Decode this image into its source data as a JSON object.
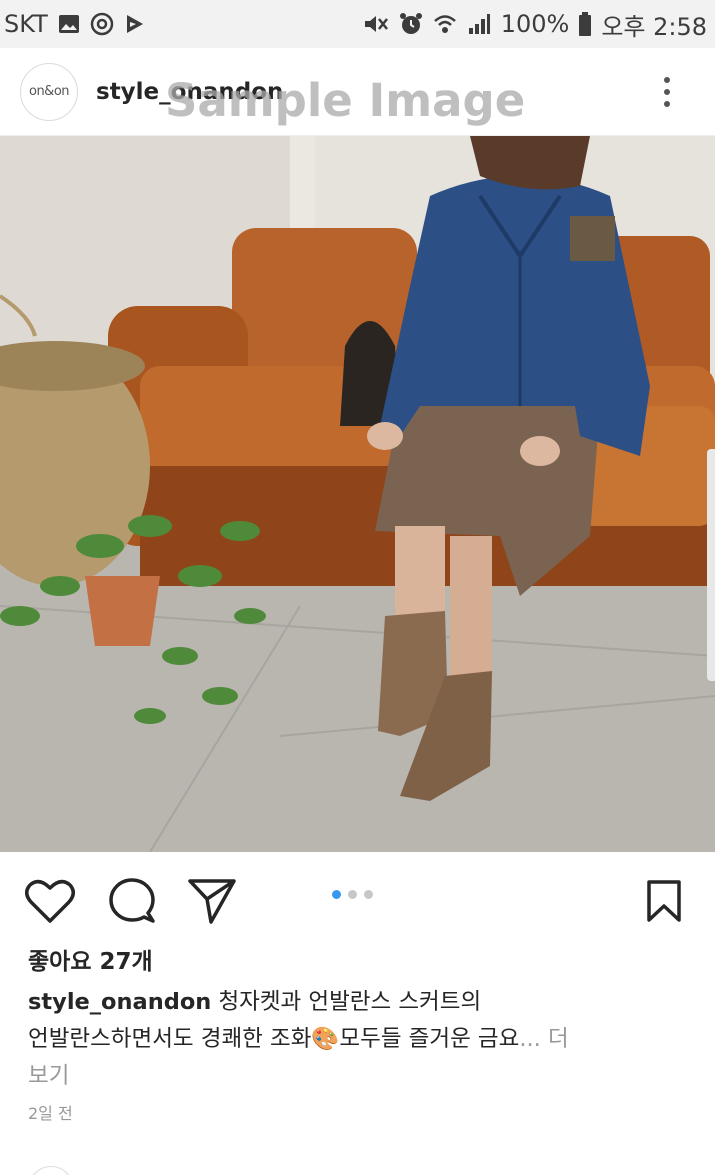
{
  "status_bar": {
    "carrier": "SKT",
    "battery": "100%",
    "time": "오후 2:58",
    "icons": [
      "gallery-icon",
      "sync-icon",
      "play-store-icon",
      "mute-icon",
      "alarm-icon",
      "wifi-icon",
      "signal-icon",
      "battery-icon"
    ]
  },
  "post": {
    "avatar_text": "on&on",
    "username": "style_onandon",
    "watermark": "Sample Image",
    "photo_description_icon": "photo",
    "carousel": {
      "count": 3,
      "active_index": 0
    },
    "likes": "좋아요 27개",
    "caption_user": "style_onandon",
    "caption_line1": " 청자켓과 언발란스 스커트의",
    "caption_line2": "언발란스하면서도 경쾌한 조화",
    "caption_emoji": "🎨",
    "caption_line2b": "모두들 즐거운 금요",
    "caption_ellipsis": "...",
    "more_label_1": " 더",
    "more_label_2": "보기",
    "time_ago": "2일 전"
  },
  "colors": {
    "accent_blue": "#3897f0",
    "text": "#262626",
    "muted": "#999999"
  }
}
